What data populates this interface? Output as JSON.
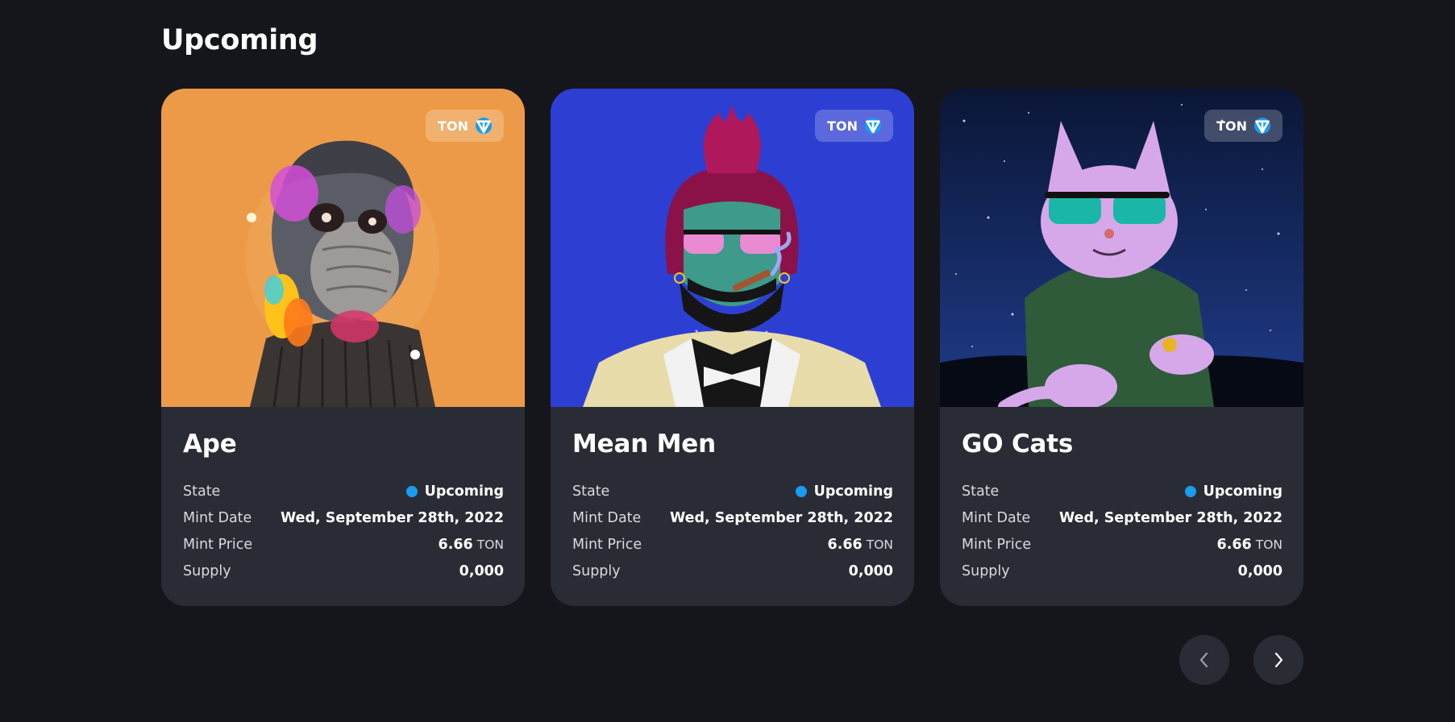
{
  "section": {
    "title": "Upcoming"
  },
  "labels": {
    "state": "State",
    "mint_date": "Mint Date",
    "mint_price": "Mint Price",
    "supply": "Supply"
  },
  "cards": [
    {
      "name": "Ape",
      "chain": "TON",
      "state": "Upcoming",
      "mint_date": "Wed, September 28th, 2022",
      "mint_price": "6.66",
      "price_unit": "TON",
      "supply": "0,000",
      "art_bg": "#ec9a47",
      "art_icon": "ape-artwork-icon"
    },
    {
      "name": "Mean Men",
      "chain": "TON",
      "state": "Upcoming",
      "mint_date": "Wed, September 28th, 2022",
      "mint_price": "6.66",
      "price_unit": "TON",
      "supply": "0,000",
      "art_bg": "#2d3fd3",
      "art_icon": "mean-man-artwork-icon"
    },
    {
      "name": "GO Cats",
      "chain": "TON",
      "state": "Upcoming",
      "mint_date": "Wed, September 28th, 2022",
      "mint_price": "6.66",
      "price_unit": "TON",
      "supply": "0,000",
      "art_bg": "#0f1e48",
      "art_icon": "cat-artwork-icon"
    }
  ],
  "colors": {
    "background": "#15161b",
    "card": "#2a2c35",
    "accent": "#1a9bf0"
  },
  "nav": {
    "prev_icon": "chevron-left-icon",
    "next_icon": "chevron-right-icon"
  }
}
